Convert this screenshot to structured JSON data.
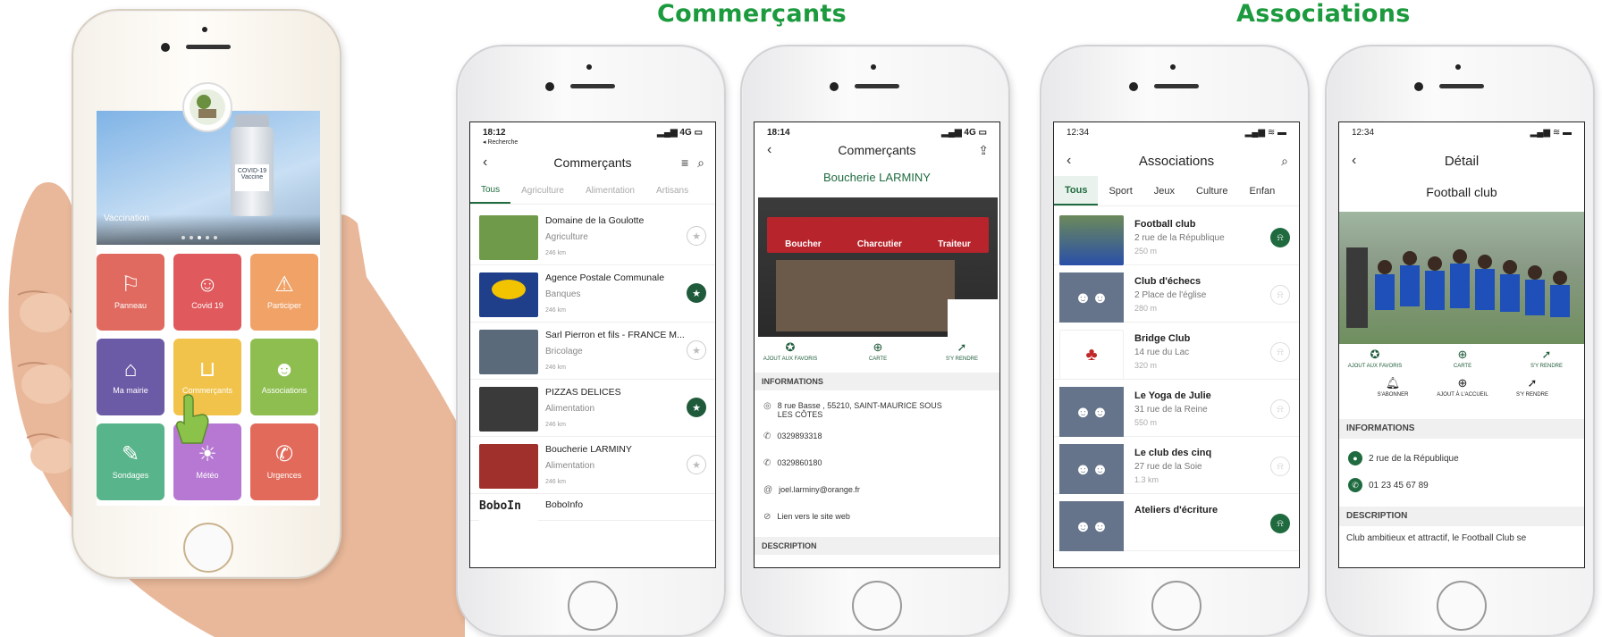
{
  "headers": {
    "commercants": "Commerçants",
    "associations": "Associations"
  },
  "home": {
    "banner_caption": "Vaccination",
    "vial_label": "COVID-19 Vaccine",
    "tiles": [
      {
        "label": "Panneau",
        "icon": "sign-icon",
        "color": "#e06a5f"
      },
      {
        "label": "Covid 19",
        "icon": "mask-icon",
        "color": "#e0595c"
      },
      {
        "label": "Participer",
        "icon": "warning-icon",
        "color": "#f0a267"
      },
      {
        "label": "Ma mairie",
        "icon": "townhall-icon",
        "color": "#6b5aa6"
      },
      {
        "label": "Commerçants",
        "icon": "basket-icon",
        "color": "#f2c34a"
      },
      {
        "label": "Associations",
        "icon": "people-icon",
        "color": "#8dbe4f"
      },
      {
        "label": "Sondages",
        "icon": "poll-icon",
        "color": "#58b48a"
      },
      {
        "label": "Météo",
        "icon": "sun-icon",
        "color": "#b678d2"
      },
      {
        "label": "Urgences",
        "icon": "phone-icon",
        "color": "#e26a5a"
      }
    ]
  },
  "list_screen": {
    "time": "18:12",
    "back_link": "◂ Recherche",
    "signal": "4G",
    "title": "Commerçants",
    "tabs": [
      "Tous",
      "Agriculture",
      "Alimentation",
      "Artisans"
    ],
    "items": [
      {
        "name": "Domaine de la Goulotte",
        "category": "Agriculture",
        "distance": "246 km",
        "fav": false
      },
      {
        "name": "Agence Postale Communale",
        "category": "Banques",
        "distance": "246 km",
        "fav": true
      },
      {
        "name": "Sarl Pierron et fils - FRANCE M...",
        "category": "Bricolage",
        "distance": "246 km",
        "fav": false
      },
      {
        "name": "PIZZAS DELICES",
        "category": "Alimentation",
        "distance": "246 km",
        "fav": true
      },
      {
        "name": "Boucherie  LARMINY",
        "category": "Alimentation",
        "distance": "246 km",
        "fav": false
      },
      {
        "name": "BoboInfo",
        "category": "",
        "distance": "",
        "fav": false
      }
    ],
    "last_logo": "BoboIn"
  },
  "shop_screen": {
    "time": "18:14",
    "signal": "4G",
    "title": "Commerçants",
    "shop_name": "Boucherie  LARMINY",
    "awning": [
      "Boucher",
      "Charcutier",
      "Traiteur"
    ],
    "actions": [
      "AJOUT AUX FAVORIS",
      "CARTE",
      "S'Y RENDRE"
    ],
    "info_header": "INFORMATIONS",
    "address": "8 rue Basse , 55210, SAINT-MAURICE SOUS LES CÔTES",
    "phone1": "0329893318",
    "phone2": "0329860180",
    "email": "joel.larminy@orange.fr",
    "website": "Lien vers le site web",
    "desc_header": "DESCRIPTION"
  },
  "assoc_screen": {
    "time": "12:34",
    "title": "Associations",
    "tabs": [
      "Tous",
      "Sport",
      "Jeux",
      "Culture",
      "Enfan"
    ],
    "items": [
      {
        "name": "Football club",
        "address": "2 rue de la République",
        "distance": "250 m",
        "subscribed": true
      },
      {
        "name": "Club d'échecs",
        "address": "2 Place de l'église",
        "distance": "280 m",
        "subscribed": false
      },
      {
        "name": "Bridge Club",
        "address": "14 rue du Lac",
        "distance": "320 m",
        "subscribed": false
      },
      {
        "name": "Le Yoga de Julie",
        "address": "31 rue de la Reine",
        "distance": "550 m",
        "subscribed": false
      },
      {
        "name": "Le club des cinq",
        "address": "27 rue de la Soie",
        "distance": "1.3 km",
        "subscribed": false
      },
      {
        "name": "Ateliers d'écriture",
        "address": "",
        "distance": "",
        "subscribed": true
      }
    ]
  },
  "detail_screen": {
    "time": "12:34",
    "title": "Détail",
    "club_name": "Football club",
    "actions_top": [
      "AJOUT AUX FAVORIS",
      "CARTE",
      "S'Y RENDRE"
    ],
    "actions_bottom": [
      "S'ABONNER",
      "AJOUT À L'ACCUEIL",
      "S'Y RENDRE"
    ],
    "info_header": "INFORMATIONS",
    "address": "2 rue de la République",
    "phone": "01 23 45 67 89",
    "desc_header": "DESCRIPTION",
    "description": "Club ambitieux et attractif, le Football Club se"
  }
}
